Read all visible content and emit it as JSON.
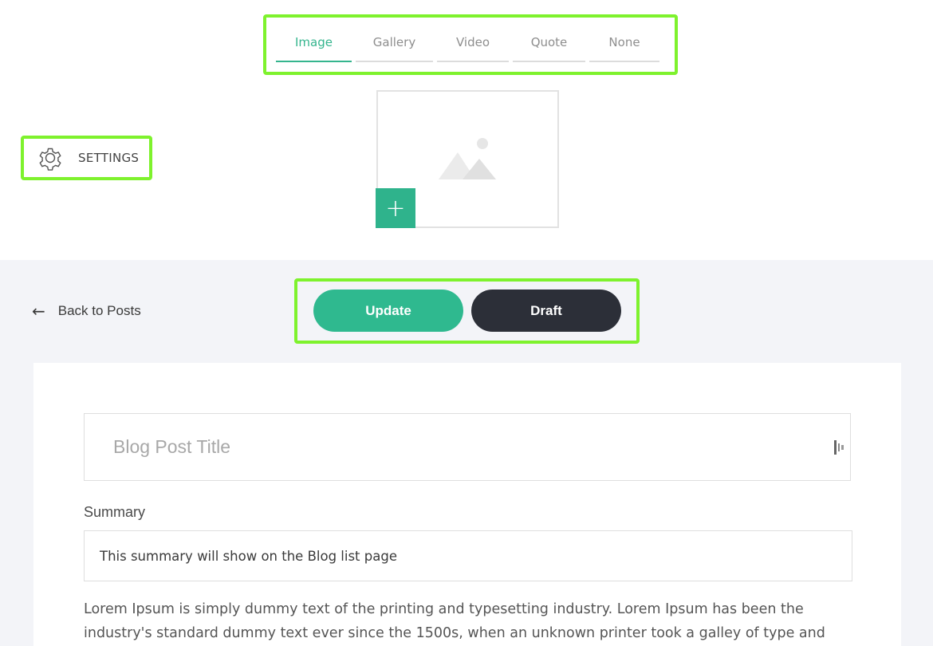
{
  "post_type_tabs": [
    {
      "label": "Image",
      "active": true
    },
    {
      "label": "Gallery",
      "active": false
    },
    {
      "label": "Video",
      "active": false
    },
    {
      "label": "Quote",
      "active": false
    },
    {
      "label": "None",
      "active": false
    }
  ],
  "image_upload": {
    "add_label": "+"
  },
  "settings": {
    "label": "SETTINGS",
    "icon": "gear-icon"
  },
  "nav": {
    "back_arrow": "←",
    "back_label": "Back to Posts"
  },
  "actions": {
    "update_label": "Update",
    "draft_label": "Draft"
  },
  "form": {
    "title_placeholder": "Blog Post Title",
    "summary_label": "Summary",
    "summary_value": "This summary will show on the Blog list page",
    "body_text": "Lorem Ipsum is simply dummy text of the printing and typesetting industry. Lorem Ipsum has been the industry's standard dummy text ever since the 1500s, when an unknown printer took a galley of type and"
  },
  "colors": {
    "accent": "#2fb98f",
    "dark_button": "#2c2f38",
    "highlight": "#7ef22d",
    "page_bg": "#f3f4f8"
  }
}
